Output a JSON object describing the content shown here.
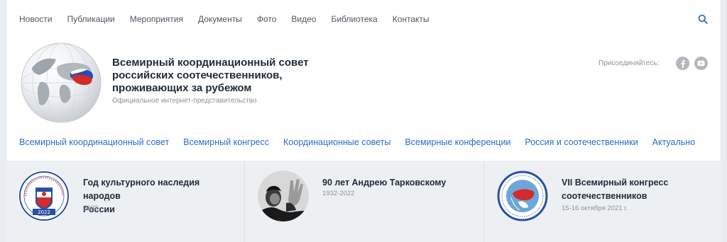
{
  "topnav": {
    "items": [
      "Новости",
      "Публикации",
      "Мероприятия",
      "Документы",
      "Фото",
      "Видео",
      "Библиотека",
      "Контакты"
    ]
  },
  "header": {
    "title_lines": [
      "Всемирный координационный совет",
      "российских соотечественников,",
      "проживающих за рубежом"
    ],
    "subtitle": "Официальное интернет-представительство",
    "join_label": "Присоединяйтесь:"
  },
  "mainnav": {
    "items": [
      "Всемирный координационный совет",
      "Всемирный конгресс",
      "Координационные советы",
      "Всемирные конференции",
      "Россия и соотечественники",
      "Актуально"
    ]
  },
  "cards": [
    {
      "title_lines": [
        "Год культурного наследия народов",
        "России"
      ],
      "date": "2022",
      "badge_text": "2022"
    },
    {
      "title_lines": [
        "90 лет Андрею Тарковскому"
      ],
      "date": "1932-2022"
    },
    {
      "title_lines": [
        "VII Всемирный конгресс",
        "соотечественников"
      ],
      "date": "15-16 октября 2021 г."
    }
  ],
  "colors": {
    "accent": "#2d6cc7",
    "title": "#1f2a3a",
    "muted": "#8b9199",
    "social": "#b3b7bc"
  },
  "icons": {
    "search": "search-icon",
    "facebook": "facebook-icon",
    "youtube": "youtube-icon"
  }
}
